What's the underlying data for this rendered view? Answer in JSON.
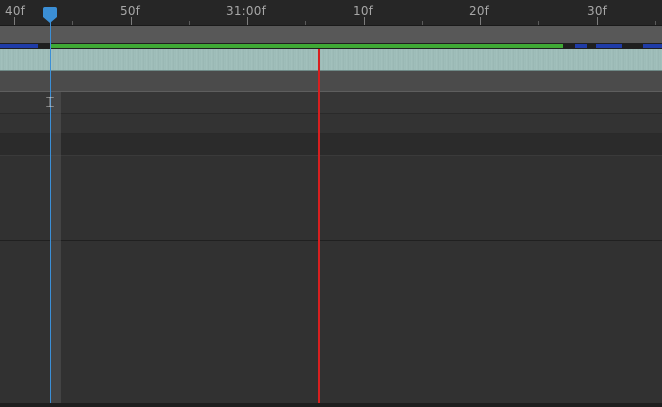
{
  "ruler": {
    "labels": [
      "40f",
      "50f",
      "31:00f",
      "10f",
      "20f",
      "30f"
    ]
  },
  "colors": {
    "playhead": "#3b8fd6",
    "marker": "#d81f1f",
    "cache": "#3fa935",
    "layer_bar": "#9bb9b5"
  },
  "icons": {
    "playhead": "playhead-icon",
    "cursor": "ibeam-cursor-icon"
  }
}
